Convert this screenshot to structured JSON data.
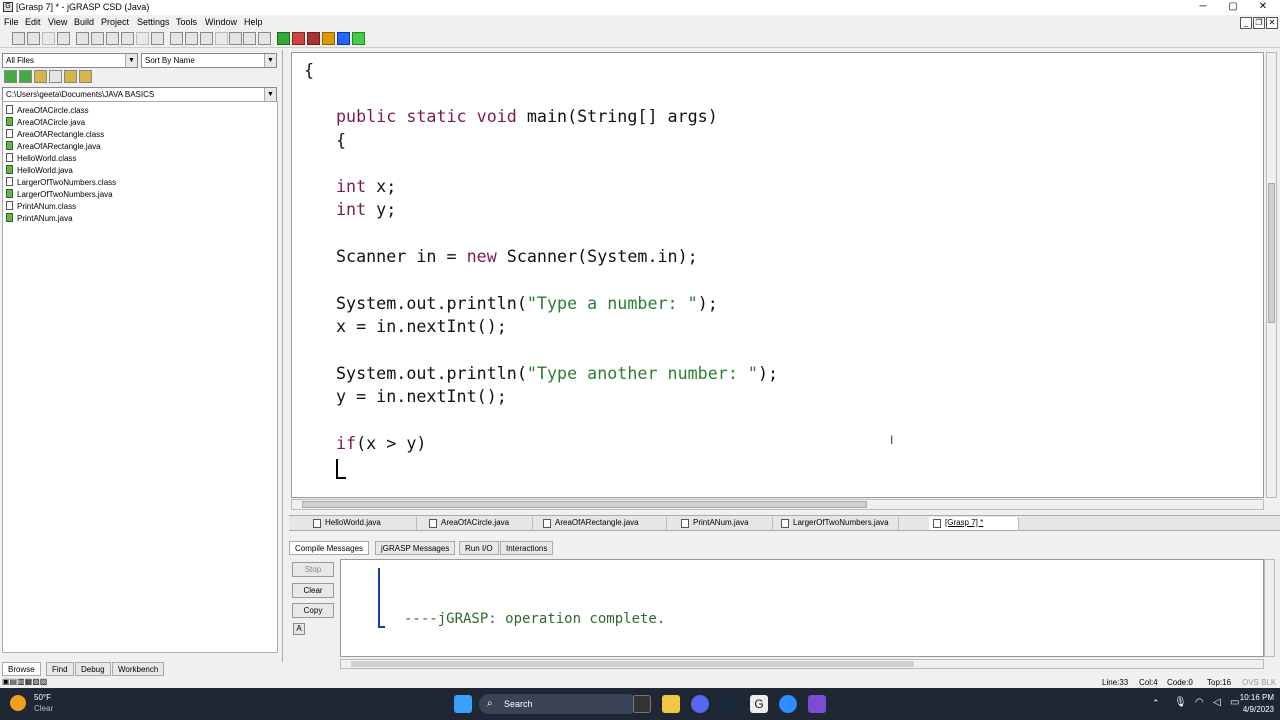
{
  "window": {
    "title": "[Grasp 7] * - jGRASP CSD (Java)",
    "min": "─",
    "max": "▢",
    "close": "✕"
  },
  "menu": [
    "File",
    "Edit",
    "View",
    "Build",
    "Project",
    "Settings",
    "Tools",
    "Window",
    "Help"
  ],
  "browse": {
    "filter": "All Files",
    "sort": "Sort By Name",
    "path": "C:\\Users\\geeta\\Documents\\JAVA BASICS",
    "files": [
      {
        "name": "AreaOfACircle.class",
        "type": "class"
      },
      {
        "name": "AreaOfACircle.java",
        "type": "java"
      },
      {
        "name": "AreaOfARectangle.class",
        "type": "class"
      },
      {
        "name": "AreaOfARectangle.java",
        "type": "java"
      },
      {
        "name": "HelloWorld.class",
        "type": "class"
      },
      {
        "name": "HelloWorld.java",
        "type": "java"
      },
      {
        "name": "LargerOfTwoNumbers.class",
        "type": "class"
      },
      {
        "name": "LargerOfTwoNumbers.java",
        "type": "java"
      },
      {
        "name": "PrintANum.class",
        "type": "class"
      },
      {
        "name": "PrintANum.java",
        "type": "java"
      }
    ],
    "tabs": [
      "Browse",
      "Find",
      "Debug",
      "Workbench"
    ]
  },
  "editor": {
    "l1": "{",
    "l2_kw": "public static void",
    "l2_rest": " main(String[] args)",
    "l3": "{",
    "l4_kw": "int",
    "l4_rest": " x;",
    "l5_kw": "int",
    "l5_rest": " y;",
    "l6_a": "Scanner in = ",
    "l6_kw": "new",
    "l6_b": " Scanner(System.in);",
    "l7_a": "System.out.println(",
    "l7_str": "\"Type a number: \"",
    "l7_b": ");",
    "l8": "x = in.nextInt();",
    "l9_a": "System.out.println(",
    "l9_str": "\"Type another number: \"",
    "l9_b": ");",
    "l10": "y = in.nextInt();",
    "l11_kw": "if",
    "l11_rest": "(x > y)",
    "l12": "█"
  },
  "doc_tabs": [
    "HelloWorld.java",
    "AreaOfACircle.java",
    "AreaOfARectangle.java",
    "PrintANum.java",
    "LargerOfTwoNumbers.java",
    "[Grasp 7] *"
  ],
  "msg_tabs": [
    "Compile Messages",
    "jGRASP Messages",
    "Run I/O",
    "Interactions"
  ],
  "msg_buttons": {
    "stop": "Stop",
    "clear": "Clear",
    "copy": "Copy"
  },
  "message": "----jGRASP: operation complete.",
  "status": {
    "line": "Line:33",
    "col": "Col:4",
    "code": "Code:0",
    "top": "Top:16",
    "mode": "OVS BLK"
  },
  "taskbar": {
    "temp": "50°F",
    "weather": "Clear",
    "search": "Search",
    "time": "10:16 PM",
    "date": "4/9/2023"
  }
}
